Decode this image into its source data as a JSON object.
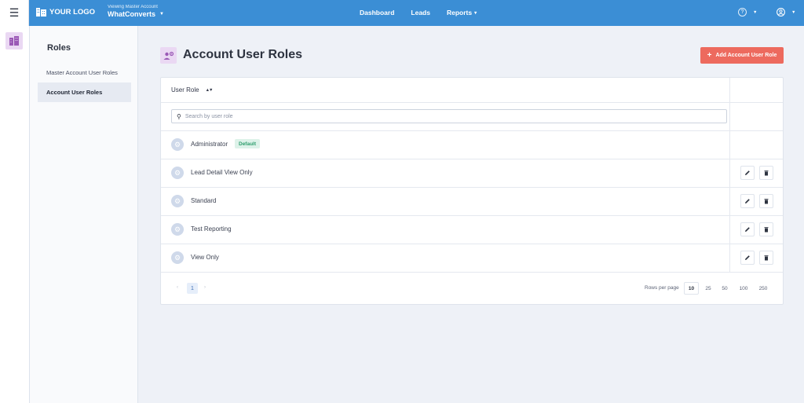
{
  "header": {
    "logo_text": "YOUR LOGO",
    "viewing_label": "Viewing Master Account",
    "account_name": "WhatConverts",
    "nav": [
      "Dashboard",
      "Leads",
      "Reports"
    ]
  },
  "subnav": {
    "title": "Roles",
    "items": [
      "Master Account User Roles",
      "Account User Roles"
    ],
    "active_index": 1
  },
  "page": {
    "title": "Account User Roles",
    "add_button": "Add Account User Role"
  },
  "table": {
    "column_header": "User Role",
    "search_placeholder": "Search by user role",
    "rows": [
      {
        "role": "Administrator",
        "badge": "Default",
        "editable": false
      },
      {
        "role": "Lead Detail View Only",
        "editable": true
      },
      {
        "role": "Standard",
        "editable": true
      },
      {
        "role": "Test Reporting",
        "editable": true
      },
      {
        "role": "View Only",
        "editable": true
      }
    ]
  },
  "pagination": {
    "current_page": "1",
    "rows_per_page_label": "Rows per page",
    "rows_per_page_options": [
      "10",
      "25",
      "50",
      "100",
      "250"
    ],
    "selected_rows_per_page": "10"
  },
  "colors": {
    "topbar": "#3b8ed5",
    "accent_button": "#ed6a5e",
    "badge_bg": "#ddf2e9",
    "badge_text": "#2f9e6e"
  }
}
